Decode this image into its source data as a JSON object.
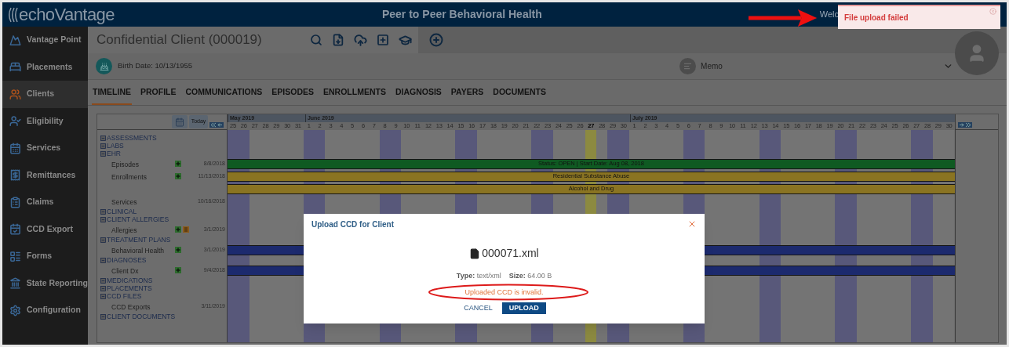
{
  "header": {
    "logo": "echoVantage",
    "title": "Peer to Peer Behavioral Health",
    "welcome": "Welc"
  },
  "toast": {
    "message": "File upload failed"
  },
  "sidebar": {
    "items": [
      {
        "label": "Vantage Point",
        "selected": false
      },
      {
        "label": "Placements",
        "selected": false
      },
      {
        "label": "Clients",
        "selected": true
      },
      {
        "label": "Eligibility",
        "selected": false
      },
      {
        "label": "Services",
        "selected": false
      },
      {
        "label": "Remittances",
        "selected": false
      },
      {
        "label": "Claims",
        "selected": false
      },
      {
        "label": "CCD Export",
        "selected": false
      },
      {
        "label": "Forms",
        "selected": false
      },
      {
        "label": "State Reporting",
        "selected": false
      },
      {
        "label": "Configuration",
        "selected": false
      }
    ]
  },
  "client": {
    "name": "Confidential Client (000019)",
    "birth_date": "Birth Date: 10/13/1955",
    "memo": "Memo"
  },
  "tabs": [
    {
      "label": "TIMELINE",
      "selected": true
    },
    {
      "label": "PROFILE",
      "selected": false
    },
    {
      "label": "COMMUNICATIONS",
      "selected": false
    },
    {
      "label": "EPISODES",
      "selected": false
    },
    {
      "label": "ENROLLMENTS",
      "selected": false
    },
    {
      "label": "DIAGNOSIS",
      "selected": false
    },
    {
      "label": "PAYERS",
      "selected": false
    },
    {
      "label": "DOCUMENTS",
      "selected": false
    }
  ],
  "timeline": {
    "today_button": "Today",
    "months": [
      {
        "label": "May 2019",
        "days": [
          {
            "label": "25",
            "weekend": true,
            "today": false
          },
          {
            "label": "26",
            "weekend": true,
            "today": false
          },
          {
            "label": "27",
            "weekend": false,
            "today": false
          },
          {
            "label": "28",
            "weekend": false,
            "today": false
          },
          {
            "label": "29",
            "weekend": false,
            "today": false
          },
          {
            "label": "30",
            "weekend": false,
            "today": false
          },
          {
            "label": "31",
            "weekend": false,
            "today": false
          }
        ]
      },
      {
        "label": "June 2019",
        "days": [
          {
            "label": "1",
            "weekend": true,
            "today": false
          },
          {
            "label": "2",
            "weekend": true,
            "today": false
          },
          {
            "label": "3",
            "weekend": false,
            "today": false
          },
          {
            "label": "4",
            "weekend": false,
            "today": false
          },
          {
            "label": "5",
            "weekend": false,
            "today": false
          },
          {
            "label": "6",
            "weekend": false,
            "today": false
          },
          {
            "label": "7",
            "weekend": false,
            "today": false
          },
          {
            "label": "8",
            "weekend": true,
            "today": false
          },
          {
            "label": "9",
            "weekend": true,
            "today": false
          },
          {
            "label": "10",
            "weekend": false,
            "today": false
          },
          {
            "label": "11",
            "weekend": false,
            "today": false
          },
          {
            "label": "12",
            "weekend": false,
            "today": false
          },
          {
            "label": "13",
            "weekend": false,
            "today": false
          },
          {
            "label": "14",
            "weekend": false,
            "today": false
          },
          {
            "label": "15",
            "weekend": true,
            "today": false
          },
          {
            "label": "16",
            "weekend": true,
            "today": false
          },
          {
            "label": "17",
            "weekend": false,
            "today": false
          },
          {
            "label": "18",
            "weekend": false,
            "today": false
          },
          {
            "label": "19",
            "weekend": false,
            "today": false
          },
          {
            "label": "20",
            "weekend": false,
            "today": false
          },
          {
            "label": "21",
            "weekend": false,
            "today": false
          },
          {
            "label": "22",
            "weekend": true,
            "today": false
          },
          {
            "label": "23",
            "weekend": true,
            "today": false
          },
          {
            "label": "24",
            "weekend": false,
            "today": false
          },
          {
            "label": "25",
            "weekend": false,
            "today": false
          },
          {
            "label": "26",
            "weekend": false,
            "today": false
          },
          {
            "label": "27",
            "weekend": false,
            "today": true
          },
          {
            "label": "28",
            "weekend": false,
            "today": false
          },
          {
            "label": "29",
            "weekend": true,
            "today": false
          },
          {
            "label": "30",
            "weekend": true,
            "today": false
          }
        ]
      },
      {
        "label": "July 2019",
        "days": [
          {
            "label": "1",
            "weekend": false,
            "today": false
          },
          {
            "label": "2",
            "weekend": false,
            "today": false
          },
          {
            "label": "3",
            "weekend": false,
            "today": false
          },
          {
            "label": "4",
            "weekend": false,
            "today": false
          },
          {
            "label": "5",
            "weekend": false,
            "today": false
          },
          {
            "label": "6",
            "weekend": true,
            "today": false
          },
          {
            "label": "7",
            "weekend": true,
            "today": false
          },
          {
            "label": "8",
            "weekend": false,
            "today": false
          },
          {
            "label": "9",
            "weekend": false,
            "today": false
          },
          {
            "label": "10",
            "weekend": false,
            "today": false
          },
          {
            "label": "11",
            "weekend": false,
            "today": false
          },
          {
            "label": "12",
            "weekend": false,
            "today": false
          },
          {
            "label": "13",
            "weekend": true,
            "today": false
          },
          {
            "label": "14",
            "weekend": true,
            "today": false
          },
          {
            "label": "15",
            "weekend": false,
            "today": false
          },
          {
            "label": "16",
            "weekend": false,
            "today": false
          },
          {
            "label": "17",
            "weekend": false,
            "today": false
          },
          {
            "label": "18",
            "weekend": false,
            "today": false
          },
          {
            "label": "19",
            "weekend": false,
            "today": false
          },
          {
            "label": "20",
            "weekend": true,
            "today": false
          },
          {
            "label": "21",
            "weekend": true,
            "today": false
          },
          {
            "label": "22",
            "weekend": false,
            "today": false
          },
          {
            "label": "23",
            "weekend": false,
            "today": false
          },
          {
            "label": "24",
            "weekend": false,
            "today": false
          },
          {
            "label": "25",
            "weekend": false,
            "today": false
          },
          {
            "label": "26",
            "weekend": false,
            "today": false
          },
          {
            "label": "27",
            "weekend": true,
            "today": false
          },
          {
            "label": "28",
            "weekend": true,
            "today": false
          },
          {
            "label": "29",
            "weekend": false,
            "today": false
          },
          {
            "label": "30",
            "weekend": false,
            "today": false
          }
        ]
      }
    ],
    "rows": [
      {
        "kind": "section",
        "label": "ASSESSMENTS",
        "expanded": true
      },
      {
        "kind": "section",
        "label": "LABS",
        "expanded": true
      },
      {
        "kind": "section",
        "label": "EHR",
        "expanded": true
      },
      {
        "kind": "item",
        "label": "Episodes",
        "date": "8/8/2018",
        "addable": true,
        "bars": [
          {
            "label": "Status: OPEN | Start Date: Aug 08, 2018",
            "color": "#0f5a22"
          }
        ]
      },
      {
        "kind": "item",
        "label": "Enrollments",
        "date": "11/13/2018",
        "addable": true,
        "bars": [
          {
            "label": "Residential Substance Abuse",
            "color": "#8a7422"
          },
          {
            "label": "Alcohol and Drug",
            "color": "#8a7422"
          }
        ]
      },
      {
        "kind": "item",
        "label": "Services",
        "date": "10/16/2018"
      },
      {
        "kind": "section",
        "label": "CLINICAL",
        "expanded": true
      },
      {
        "kind": "section",
        "label": "CLIENT ALLERGIES",
        "expanded": true
      },
      {
        "kind": "item",
        "label": "Allergies",
        "date": "3/1/2019",
        "addable": true,
        "editable": true
      },
      {
        "kind": "section",
        "label": "TREATMENT PLANS",
        "expanded": true
      },
      {
        "kind": "item",
        "label": "Behavioral Health",
        "date": "3/1/2019",
        "addable": true,
        "bars": [
          {
            "color": "#1c2a6e"
          }
        ]
      },
      {
        "kind": "section",
        "label": "DIAGNOSES",
        "expanded": true
      },
      {
        "kind": "item",
        "label": "Client Dx",
        "date": "9/4/2018",
        "addable": true,
        "bars": [
          {
            "color": "#1c2a6e"
          }
        ]
      },
      {
        "kind": "section",
        "label": "MEDICATIONS",
        "expanded": true
      },
      {
        "kind": "section",
        "label": "PLACEMENTS",
        "expanded": true
      },
      {
        "kind": "section",
        "label": "CCD FILES",
        "expanded": true
      },
      {
        "kind": "item",
        "label": "CCD Exports",
        "date": "3/11/2019"
      },
      {
        "kind": "section",
        "label": "CLIENT DOCUMENTS",
        "expanded": true
      }
    ]
  },
  "dialog": {
    "title": "Upload CCD for Client",
    "file_name": "000071.xml",
    "type": "**Type:** text/xml",
    "size": "**Size:** 64.00 B",
    "error": "Uploaded CCD is invalid.",
    "buttons": [
      {
        "label": "CANCEL",
        "kind": "link"
      },
      {
        "label": "UPLOAD",
        "kind": "primary"
      }
    ]
  }
}
